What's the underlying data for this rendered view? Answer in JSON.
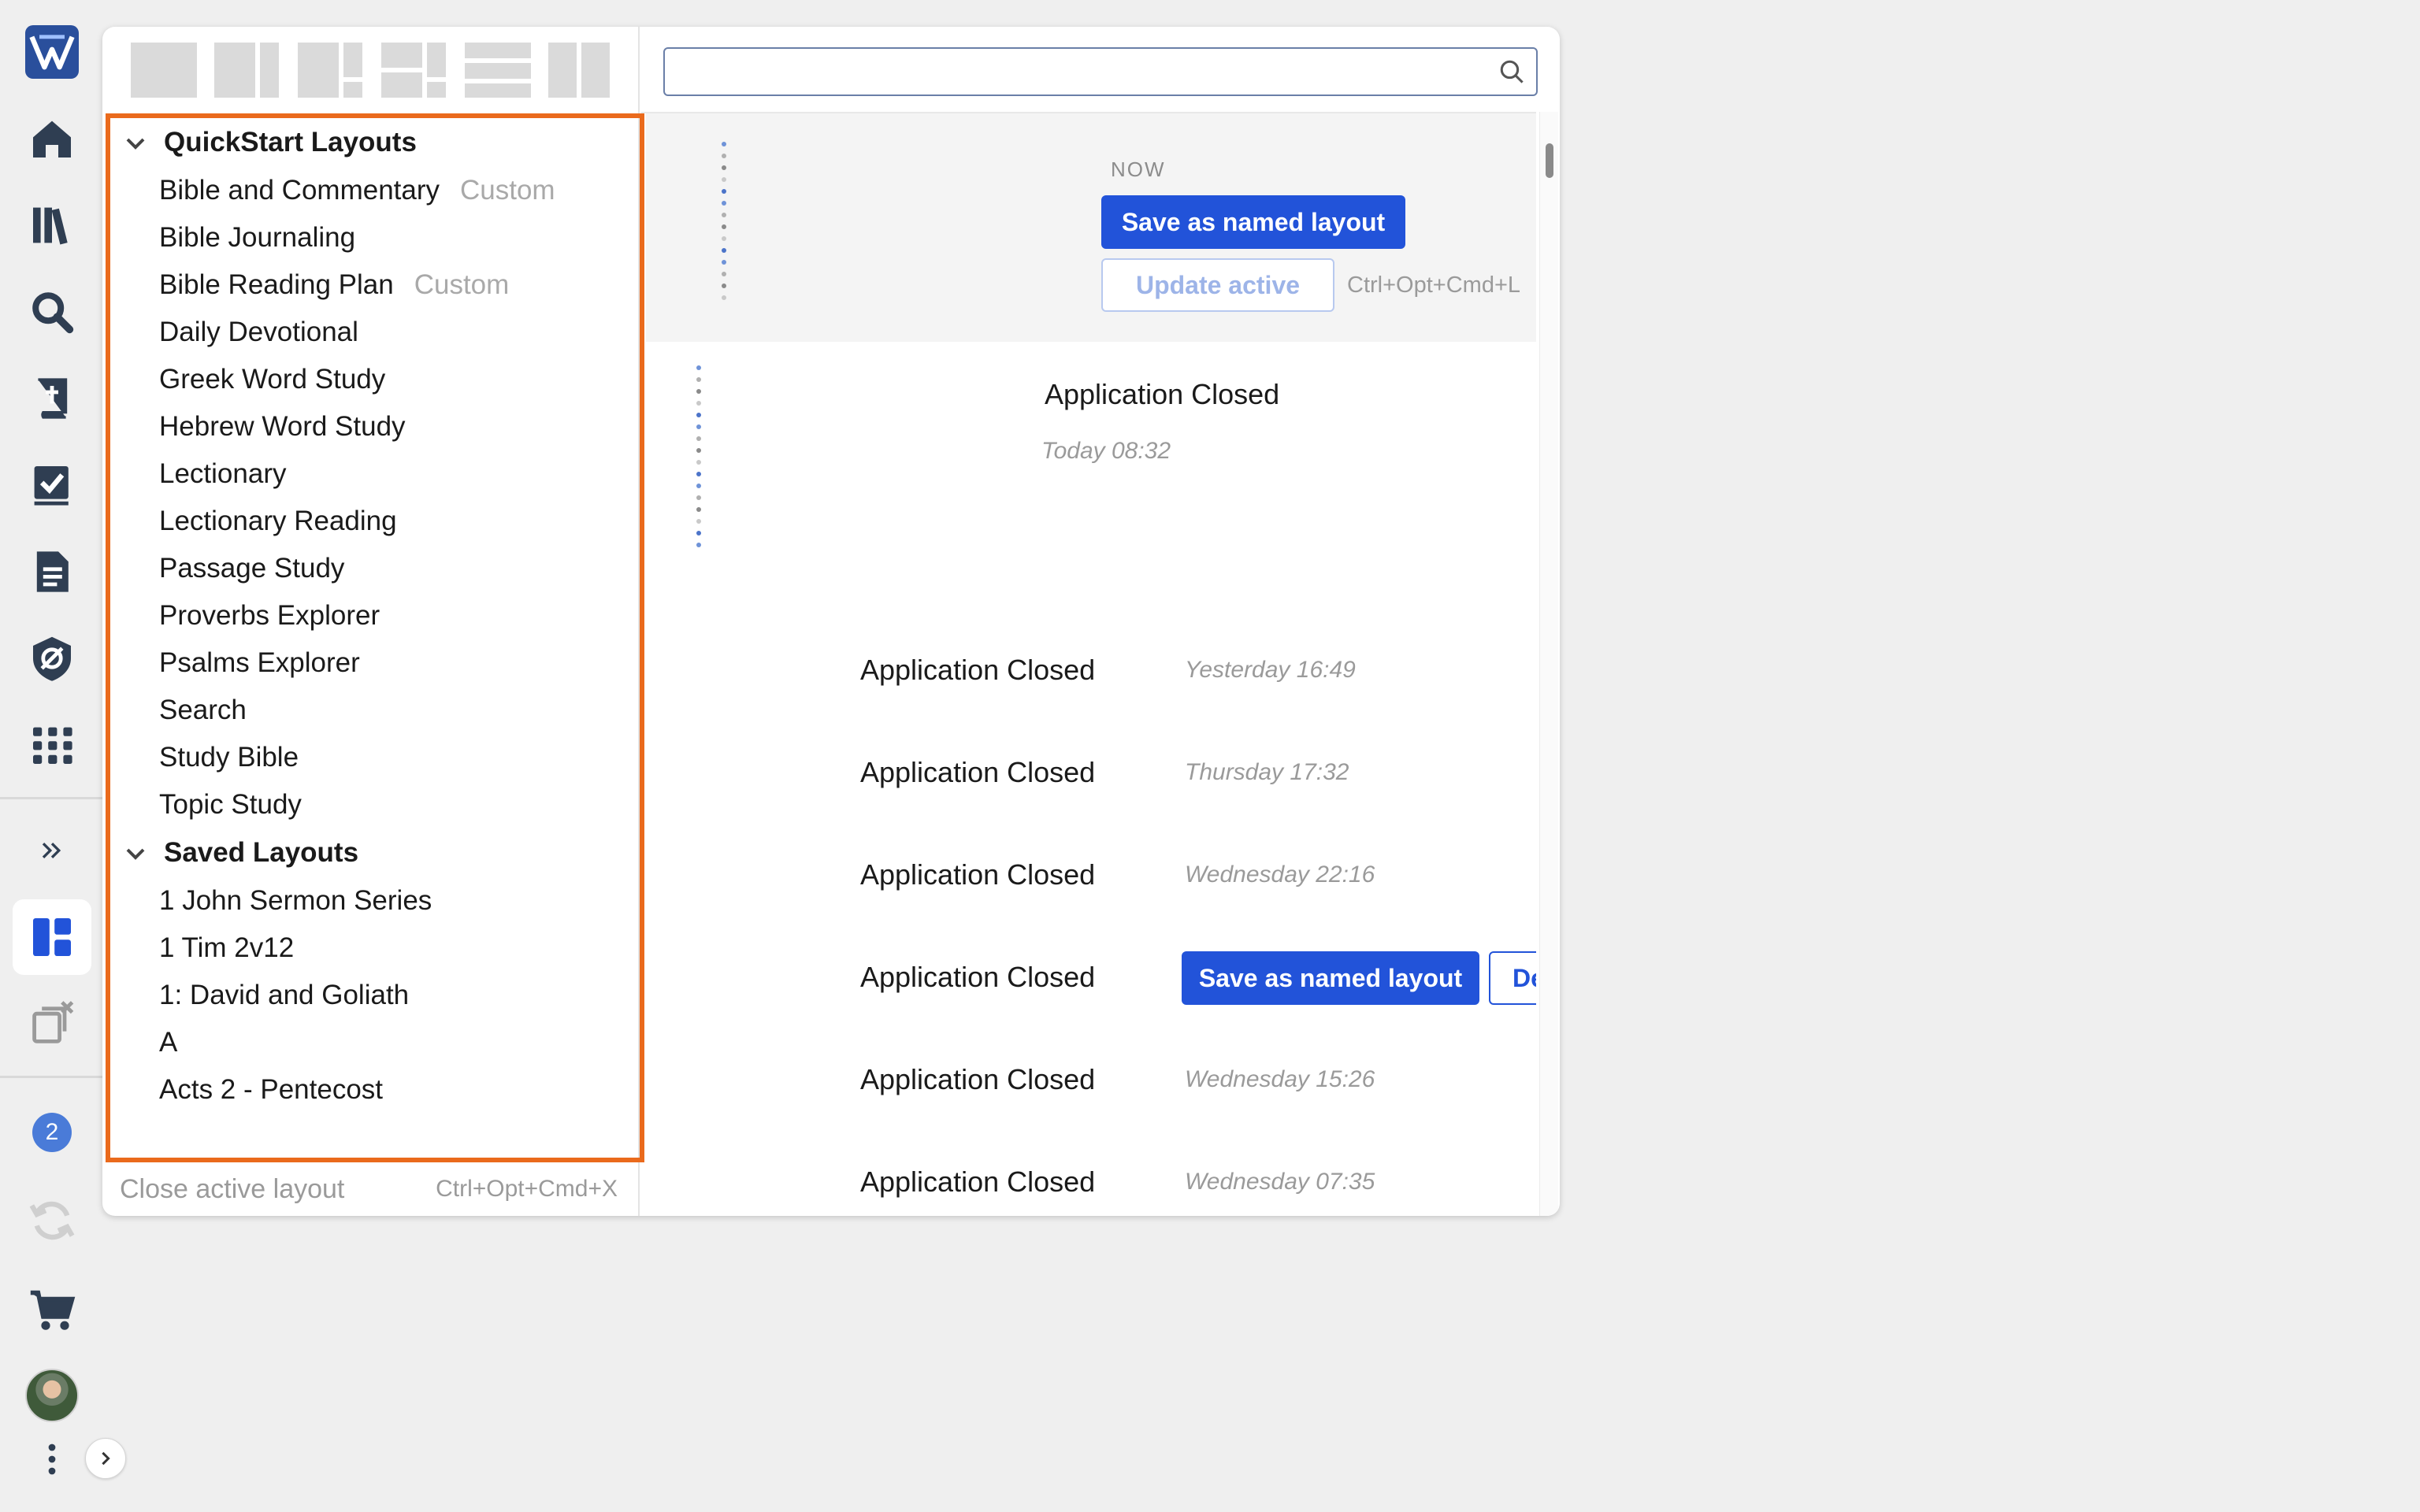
{
  "rail": {
    "icons": [
      "logo-icon",
      "home-icon",
      "library-icon",
      "search-icon",
      "bible-icon",
      "tasks-icon",
      "document-icon",
      "settings-shield-icon",
      "apps-grid-icon",
      "expand-icon",
      "layouts-icon",
      "close-layouts-icon",
      "notifications-icon",
      "sync-icon",
      "cart-icon",
      "avatar",
      "more-icon"
    ],
    "notifications_badge": "2"
  },
  "colors": {
    "accent": "#2253d9",
    "highlight_border": "#ea6a1c",
    "logo_bg": "#2a4f9c",
    "badge_bg": "#4a7bd8"
  },
  "search": {
    "value": "",
    "placeholder": ""
  },
  "groups": [
    {
      "title": "QuickStart Layouts",
      "items": [
        {
          "label": "Bible and Commentary",
          "tag": "Custom"
        },
        {
          "label": "Bible Journaling",
          "tag": ""
        },
        {
          "label": "Bible Reading Plan",
          "tag": "Custom"
        },
        {
          "label": "Daily Devotional",
          "tag": ""
        },
        {
          "label": "Greek Word Study",
          "tag": ""
        },
        {
          "label": "Hebrew Word Study",
          "tag": ""
        },
        {
          "label": "Lectionary",
          "tag": ""
        },
        {
          "label": "Lectionary Reading",
          "tag": ""
        },
        {
          "label": "Passage Study",
          "tag": ""
        },
        {
          "label": "Proverbs Explorer",
          "tag": ""
        },
        {
          "label": "Psalms Explorer",
          "tag": ""
        },
        {
          "label": "Search",
          "tag": ""
        },
        {
          "label": "Study Bible",
          "tag": ""
        },
        {
          "label": "Topic Study",
          "tag": ""
        }
      ]
    },
    {
      "title": "Saved Layouts",
      "items": [
        {
          "label": "1 John Sermon Series",
          "tag": ""
        },
        {
          "label": "1 Tim 2v12",
          "tag": ""
        },
        {
          "label": "1: David and Goliath",
          "tag": ""
        },
        {
          "label": "A",
          "tag": ""
        },
        {
          "label": "Acts 2 - Pentecost",
          "tag": ""
        }
      ]
    }
  ],
  "footer": {
    "close_label": "Close active layout",
    "close_shortcut": "Ctrl+Opt+Cmd+X"
  },
  "now_card": {
    "label": "NOW",
    "save_label": "Save as named layout",
    "update_label": "Update active",
    "update_shortcut": "Ctrl+Opt+Cmd+L"
  },
  "history": {
    "first": {
      "title": "Application Closed",
      "time": "Today 08:32"
    },
    "entries": [
      {
        "title": "Application Closed",
        "time": "Yesterday 16:49"
      },
      {
        "title": "Application Closed",
        "time": "Thursday 17:32"
      },
      {
        "title": "Application Closed",
        "time": "Wednesday 22:16"
      },
      {
        "title": "Application Closed",
        "time": ""
      },
      {
        "title": "Application Closed",
        "time": "Wednesday 15:26"
      },
      {
        "title": "Application Closed",
        "time": "Wednesday 07:35"
      }
    ],
    "hover_save_label": "Save as named layout",
    "hover_delete_label": "Delete"
  }
}
